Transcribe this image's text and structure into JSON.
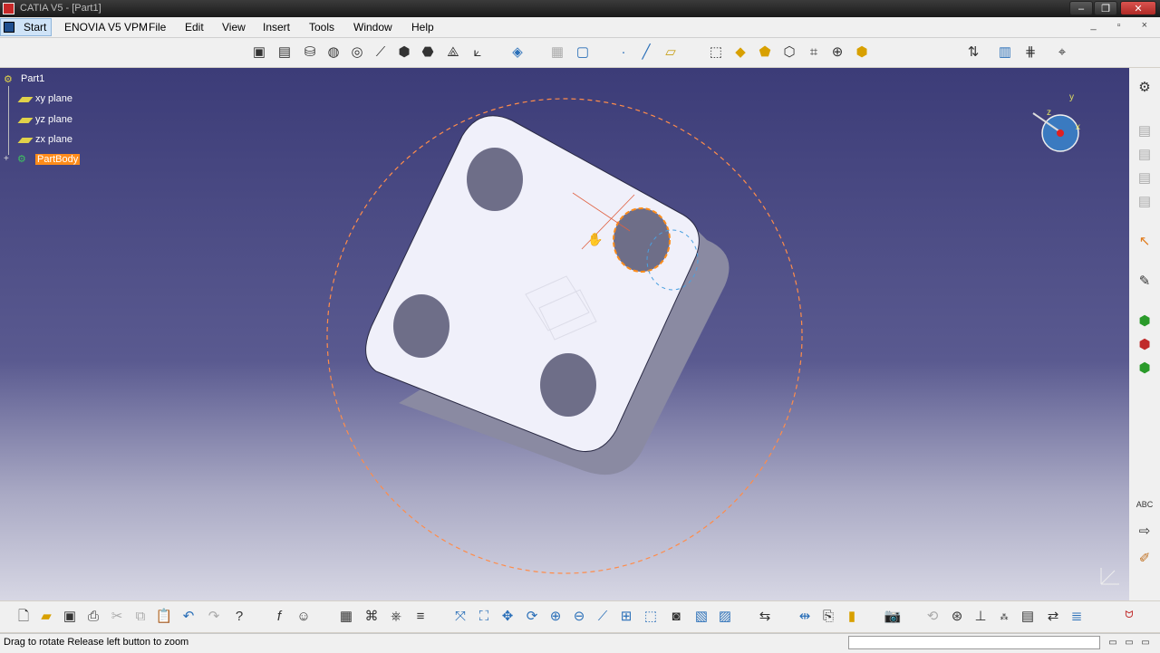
{
  "window": {
    "title": "CATIA V5 - [Part1]",
    "min": "–",
    "max": "❐",
    "close": "✕"
  },
  "menu": {
    "start": "Start",
    "items": [
      "ENOVIA V5 VPM",
      "File",
      "Edit",
      "View",
      "Insert",
      "Tools",
      "Window",
      "Help"
    ],
    "doc_controls": "_ ▫ ×"
  },
  "tree": {
    "root": "Part1",
    "items": [
      {
        "label": "xy plane",
        "icon": "plane-icon"
      },
      {
        "label": "yz plane",
        "icon": "plane-icon"
      },
      {
        "label": "zx plane",
        "icon": "plane-icon"
      },
      {
        "label": "PartBody",
        "icon": "partbody-icon",
        "selected": true
      }
    ]
  },
  "compass": {
    "axis_y": "y",
    "axis_x": "x",
    "axis_z": "z"
  },
  "status": {
    "message": "Drag to rotate  Release left button to zoom"
  },
  "colors": {
    "bg_top": "#3c3c78",
    "bg_bottom": "#d7d7e4",
    "part_face": "#f0f0fa",
    "part_side": "#8a8aa2",
    "selection": "#ff8c1a"
  },
  "toolbars": {
    "top": [
      "pad-icon",
      "pocket-icon",
      "shaft-icon",
      "groove-icon",
      "hole-icon",
      "rib-icon",
      "slot-icon",
      "stiffener-icon",
      "loft-icon",
      "remove-loft-icon",
      "sketch-icon",
      "grid-icon",
      "points-icon",
      "line-icon",
      "plane-icon",
      "measure-icon",
      "inertia-icon",
      "apply-material-icon",
      "render-icon",
      "fly-icon",
      "compass-icon",
      "snapshot-icon",
      "show-icon",
      "grid2-icon",
      "settings-icon"
    ],
    "bottom": [
      "new-icon",
      "open-icon",
      "save-icon",
      "print-icon",
      "cut-icon",
      "copy-icon",
      "paste-icon",
      "undo-icon",
      "redo-icon",
      "help-icon",
      "formula-icon",
      "comment-icon",
      "table-icon",
      "knowledge-icon",
      "law-icon",
      "macro-icon",
      "select-icon",
      "fit-all-icon",
      "pan-icon",
      "rotate-icon",
      "zoom-in-icon",
      "zoom-out-icon",
      "normal-view-icon",
      "iso-view-icon",
      "shading-icon",
      "hide-icon",
      "swap-icon",
      "update-icon",
      "cut-plane-icon",
      "bom-icon",
      "capture-icon",
      "render2-icon",
      "fly2-icon",
      "axis-icon",
      "magnify-icon",
      "tile-icon",
      "zoom-area-icon",
      "analysis-icon",
      "catia-logo-icon"
    ],
    "right": [
      "settings-gear-icon",
      "view1-icon",
      "view2-icon",
      "view3-icon",
      "view4-icon",
      "view5-icon",
      "cursor-icon",
      "sketcher-icon",
      "draft-icon",
      "sketch2-icon",
      "sketch3-icon",
      "abc-icon",
      "arrow-icon",
      "pen-icon"
    ]
  }
}
